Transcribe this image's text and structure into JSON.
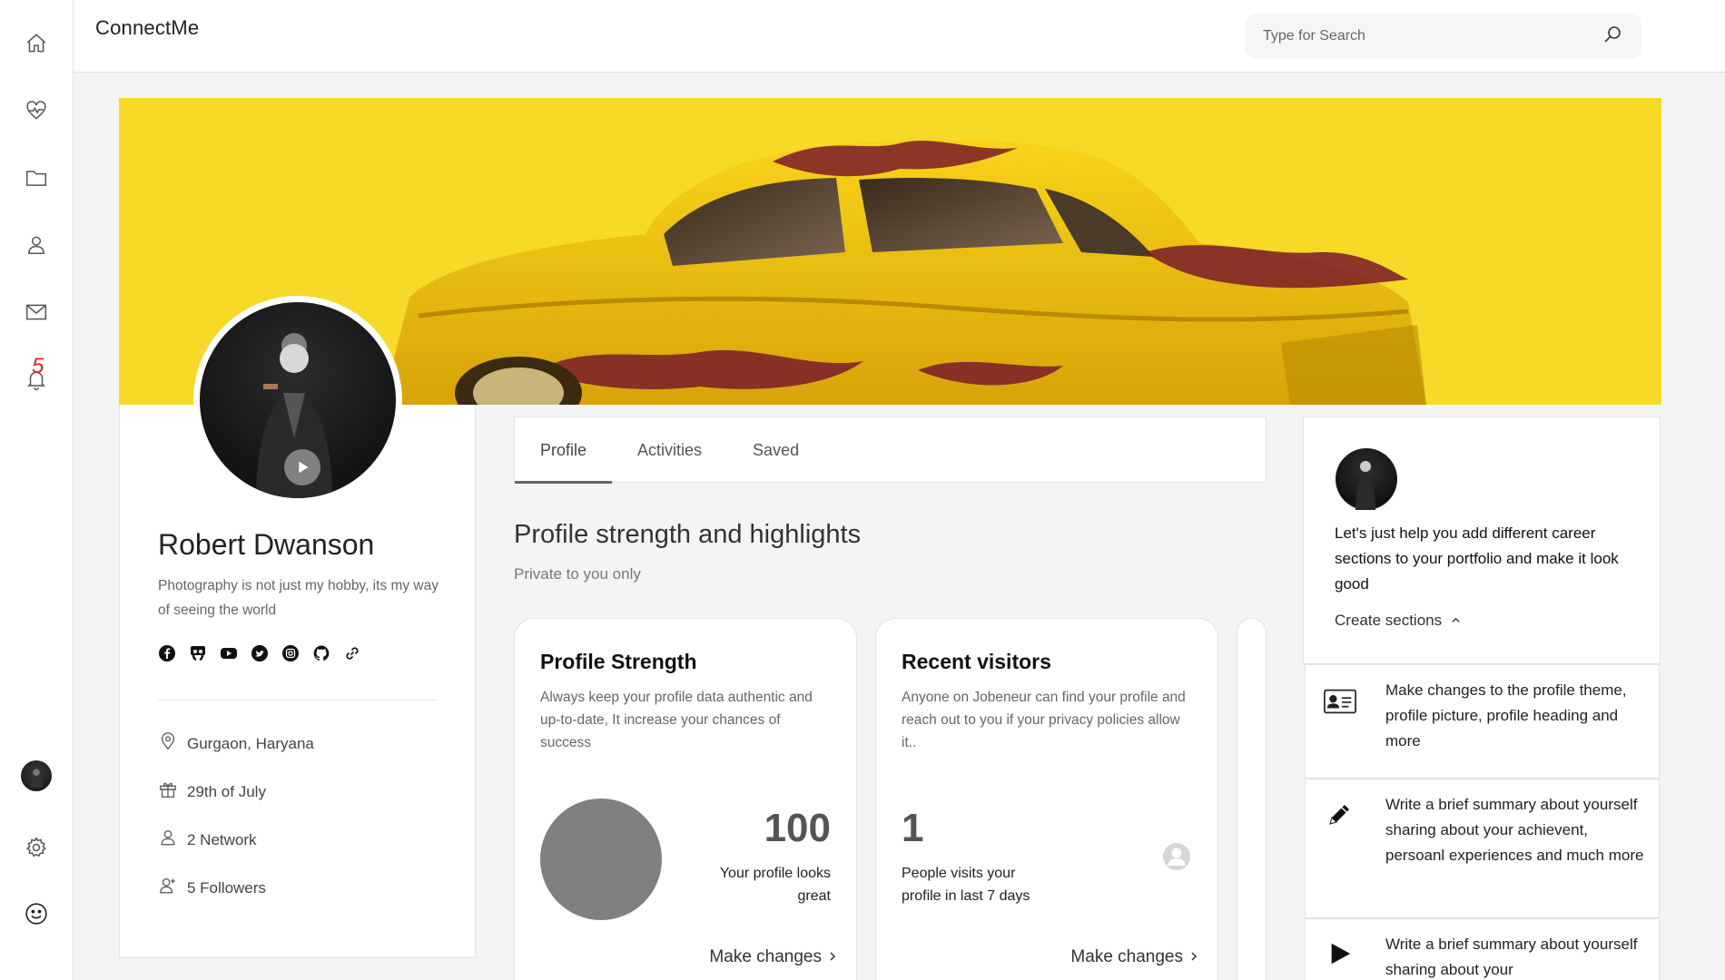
{
  "app": {
    "title": "ConnectMe"
  },
  "search": {
    "placeholder": "Type for Search"
  },
  "rail": {
    "notification_count": "5"
  },
  "profile": {
    "name": "Robert Dwanson",
    "bio": "Photography is not just my hobby, its my way of seeing the world",
    "location": "Gurgaon, Haryana",
    "birthday": "29th of July",
    "network": "2 Network",
    "followers": "5 Followers"
  },
  "tabs": [
    {
      "label": "Profile",
      "active": true
    },
    {
      "label": "Activities",
      "active": false
    },
    {
      "label": "Saved",
      "active": false
    }
  ],
  "section": {
    "title": "Profile strength and highlights",
    "subtitle": "Private to you only"
  },
  "cards": {
    "strength": {
      "title": "Profile Strength",
      "desc": "Always keep your profile data authentic and up-to-date, It increase your chances of success",
      "value": "100",
      "caption_1": "Your profile looks",
      "caption_2": "great",
      "action": "Make changes"
    },
    "visitors": {
      "title": "Recent visitors",
      "desc": "Anyone on Jobeneur can find your profile and reach out to you if your privacy policies allow it..",
      "value": "1",
      "caption_1": "People visits your",
      "caption_2": "profile in last 7 days",
      "action": "Make changes"
    }
  },
  "right": {
    "message": "Let's just help you add different career sections to your portfolio and make it look good",
    "create_label": "Create sections",
    "items": [
      {
        "icon": "id-card-icon",
        "text": "Make changes to the profile theme, profile picture, profile heading and more"
      },
      {
        "icon": "pencil-icon",
        "text": "Write a brief summary about yourself sharing about your achievent, persoanl experiences and much more"
      },
      {
        "icon": "play-icon",
        "text": "Write a brief summary about yourself sharing about your"
      }
    ]
  },
  "colors": {
    "banner": "#f7d928",
    "accent": "#666666",
    "badge": "#e02424"
  }
}
